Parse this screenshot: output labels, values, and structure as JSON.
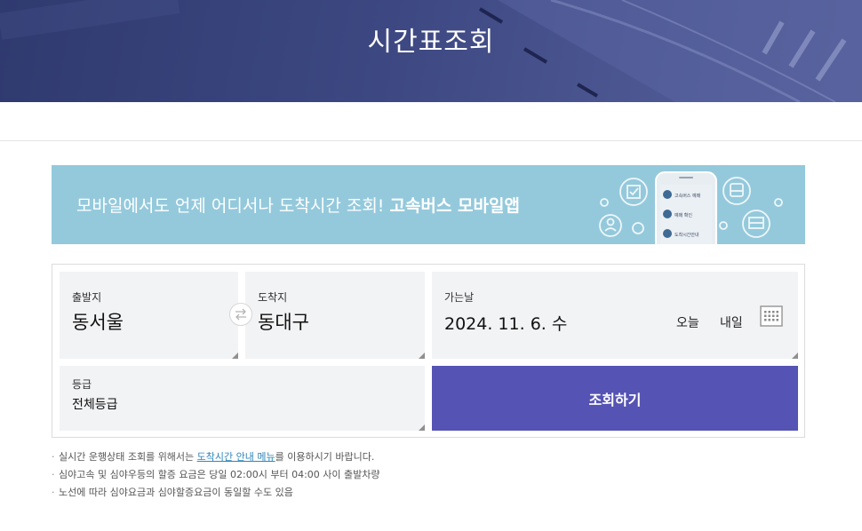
{
  "header": {
    "title": "시간표조회"
  },
  "banner": {
    "text": "모바일에서도 언제 어디서나 도착시간 조회! ",
    "highlight": "고속버스 모바일앱",
    "phone_menu": [
      "고속버스 예매",
      "예매 확인",
      "도착시간안내"
    ]
  },
  "form": {
    "departure": {
      "label": "출발지",
      "value": "동서울"
    },
    "arrival": {
      "label": "도착지",
      "value": "동대구"
    },
    "date": {
      "label": "가는날",
      "value": "2024. 11. 6. 수",
      "today_label": "오늘",
      "tomorrow_label": "내일"
    },
    "grade": {
      "label": "등급",
      "value": "전체등급"
    },
    "search_label": "조회하기"
  },
  "notes": {
    "line1_prefix": "실시간 운행상태 조회를 위해서는 ",
    "line1_link": "도착시간 안내 메뉴",
    "line1_suffix": "를 이용하시기 바랍니다.",
    "line2": "심야고속 및 심야우등의 할증 요금은 당일 02:00시 부터 04:00 사이 출발차량",
    "line3": "노선에 따라 심야요금과 심야할증요금이 동일할 수도 있음"
  },
  "colors": {
    "hero": "#3d4882",
    "banner": "#94c9dc",
    "search_button": "#5553b3",
    "link": "#2f86b8"
  }
}
